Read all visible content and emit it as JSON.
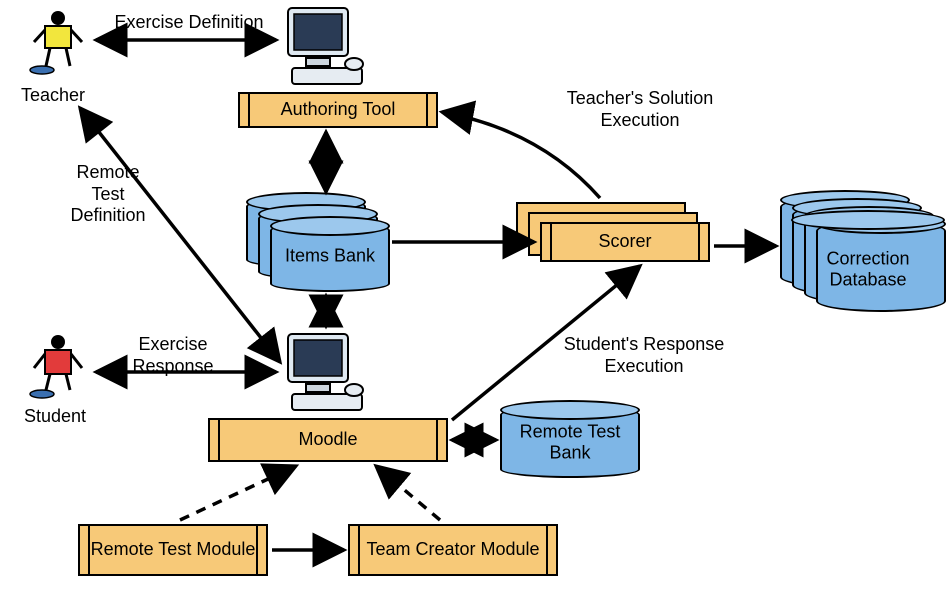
{
  "actors": {
    "teacher": "Teacher",
    "student": "Student"
  },
  "nodes": {
    "authoring_tool": "Authoring Tool",
    "items_bank": "Items Bank",
    "scorer": "Scorer",
    "correction_db": "Correction Database",
    "moodle": "Moodle",
    "remote_test_bank": "Remote Test Bank",
    "remote_test_module": "Remote Test Module",
    "team_creator_module": "Team Creator Module"
  },
  "edges": {
    "exercise_definition": "Exercise Definition",
    "remote_test_definition": "Remote Test Definition",
    "exercise_response": "Exercise Response",
    "teacher_solution_exec": "Teacher's Solution Execution",
    "student_response_exec": "Student's Response Execution"
  },
  "colors": {
    "box_fill": "#f7c978",
    "cyl_fill": "#7eb6e6"
  }
}
